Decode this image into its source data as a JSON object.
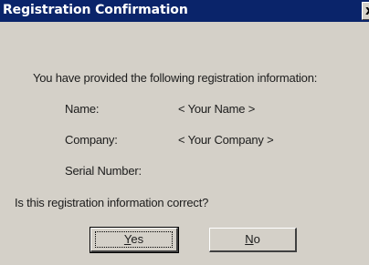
{
  "window": {
    "title": "Registration Confirmation",
    "close_glyph": "x",
    "close_icon_name": "close-icon",
    "titlebar_color": "#0a246a",
    "face_color": "#d4d0c8"
  },
  "content": {
    "intro": "You have provided the following registration information:",
    "fields": [
      {
        "label": "Name:",
        "value": "< Your Name >"
      },
      {
        "label": "Company:",
        "value": "< Your Company >"
      },
      {
        "label": "Serial Number:",
        "value": ""
      }
    ],
    "question": "Is this registration information correct?"
  },
  "buttons": {
    "yes": {
      "mnemonic": "Y",
      "rest": "es"
    },
    "no": {
      "mnemonic": "N",
      "rest": "o"
    }
  }
}
